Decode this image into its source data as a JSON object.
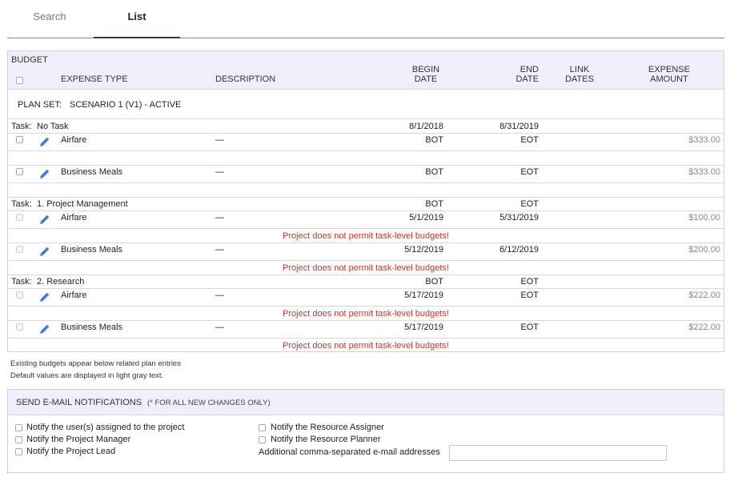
{
  "tabs": {
    "search": "Search",
    "list": "List"
  },
  "budget": {
    "title": "BUDGET",
    "headers": {
      "expense_type": "EXPENSE TYPE",
      "description": "DESCRIPTION",
      "begin_1": "BEGIN",
      "begin_2": "DATE",
      "end_1": "END",
      "end_2": "DATE",
      "link_1": "LINK",
      "link_2": "DATES",
      "amount_1": "EXPENSE",
      "amount_2": "AMOUNT"
    },
    "plan_set_label": "PLAN SET:",
    "plan_set_value": "SCENARIO 1 (V1) - ACTIVE",
    "task_label": "Task:",
    "tasks": [
      {
        "name": "No Task",
        "begin": "8/1/2018",
        "end": "8/31/2019"
      },
      {
        "name": "1. Project Management",
        "begin": "BOT",
        "end": "EOT"
      },
      {
        "name": "2. Research",
        "begin": "BOT",
        "end": "EOT"
      }
    ],
    "rows": [
      {
        "type": "Airfare",
        "desc": "—",
        "begin": "BOT",
        "end": "EOT",
        "amount": "$333.00"
      },
      {
        "type": "Business Meals",
        "desc": "—",
        "begin": "BOT",
        "end": "EOT",
        "amount": "$333.00"
      },
      {
        "type": "Airfare",
        "desc": "—",
        "begin": "5/1/2019",
        "end": "5/31/2019",
        "amount": "$100.00"
      },
      {
        "type": "Business Meals",
        "desc": "—",
        "begin": "5/12/2019",
        "end": "6/12/2019",
        "amount": "$200.00"
      },
      {
        "type": "Airfare",
        "desc": "—",
        "begin": "5/17/2019",
        "end": "EOT",
        "amount": "$222.00"
      },
      {
        "type": "Business Meals",
        "desc": "—",
        "begin": "5/17/2019",
        "end": "EOT",
        "amount": "$222.00"
      }
    ],
    "error_message": "Project does not permit task-level budgets!"
  },
  "notes": {
    "line1": "Existing budgets appear below related plan entries",
    "line2": "Default values are displayed in light gray text."
  },
  "notify": {
    "title": "SEND E-MAIL NOTIFICATIONS",
    "subtitle": "(* FOR ALL NEW CHANGES ONLY)",
    "options_left": [
      "Notify the user(s) assigned to the project",
      "Notify the Project Manager",
      "Notify the Project Lead"
    ],
    "options_right": [
      "Notify the Resource Assigner",
      "Notify the Resource Planner"
    ],
    "email_label": "Additional comma-separated e-mail addresses",
    "email_value": ""
  },
  "colors": {
    "header_bg": "#efeefa",
    "error": "#c0392b",
    "pencil": "#3b78e7"
  },
  "icons": {
    "edit": "pencil-icon"
  }
}
